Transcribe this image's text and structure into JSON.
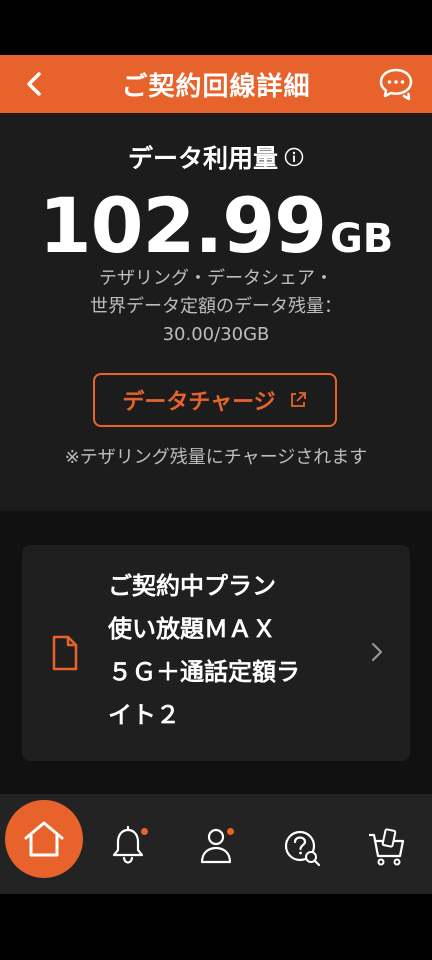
{
  "header": {
    "title": "ご契約回線詳細",
    "back_icon": "chevron-left-icon",
    "chat_icon": "chat-bubbles-icon"
  },
  "usage": {
    "label": "データ利用量",
    "amount": "102.99",
    "unit": "GB",
    "sub_line1": "テザリング・データシェア・",
    "sub_line2": "世界データ定額のデータ残量：",
    "sub_value": "30.00/30GB"
  },
  "charge": {
    "button_label": "データチャージ",
    "note": "※テザリング残量にチャージされます"
  },
  "plan": {
    "line1": "ご契約中プラン",
    "line2": "使い放題ＭＡＸ",
    "line3": "５Ｇ＋通話定額ラ",
    "line4": "イト２"
  },
  "nav": {
    "items": [
      "home-icon",
      "bell-icon",
      "user-icon",
      "help-search-icon",
      "cart-icon"
    ]
  },
  "colors": {
    "accent": "#e8632b",
    "background": "#1c1c1c"
  }
}
